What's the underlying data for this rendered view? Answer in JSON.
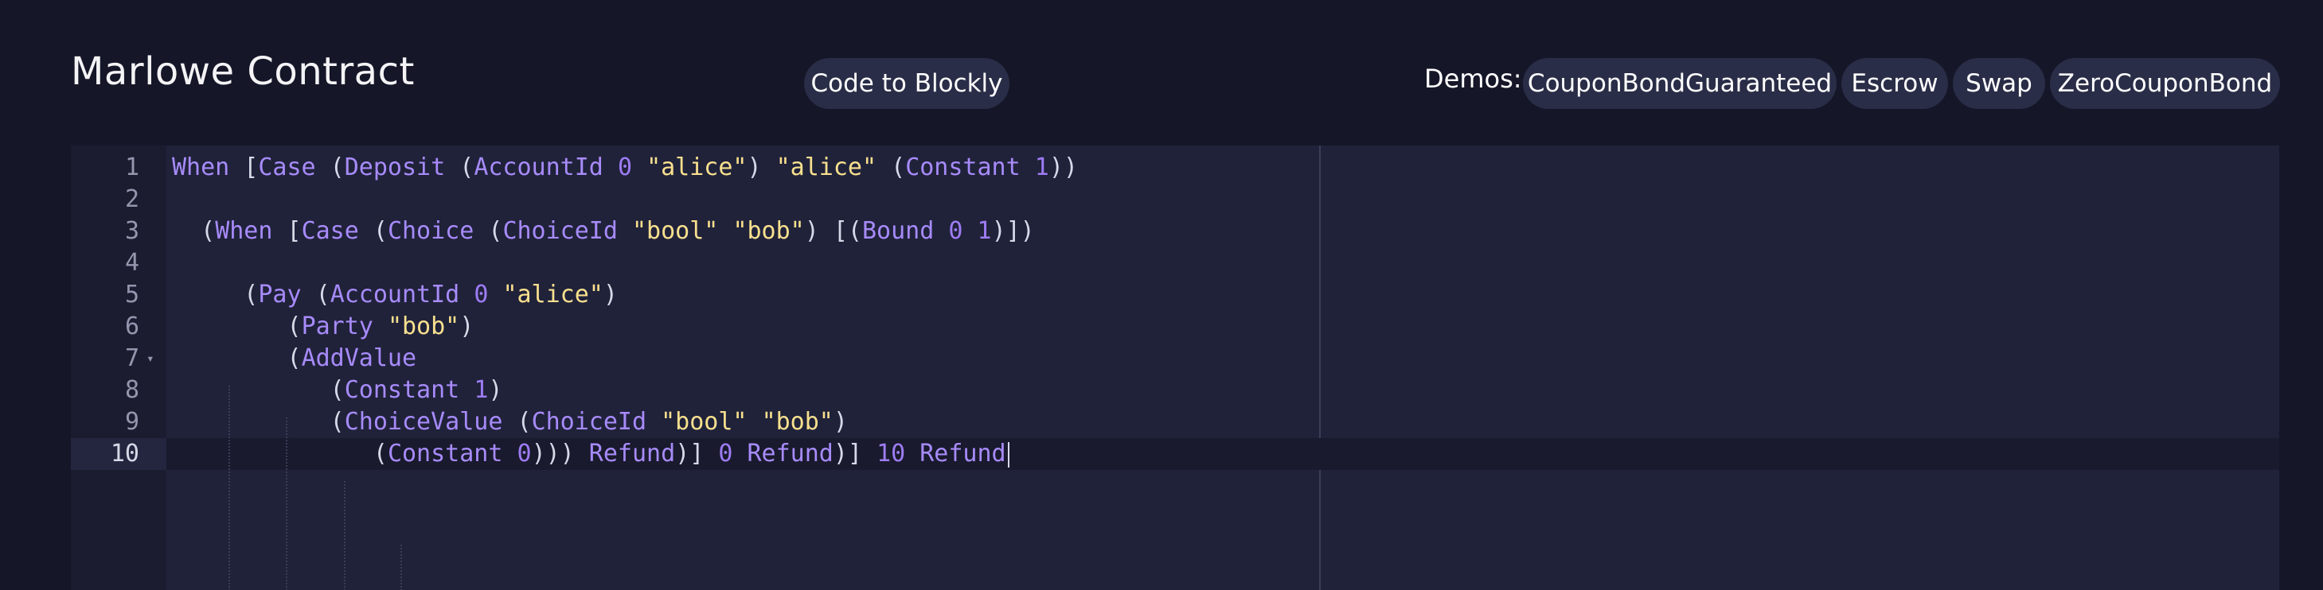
{
  "app": {
    "title": "Marlowe Contract"
  },
  "toolbar": {
    "code_to_blockly": "Code to Blockly"
  },
  "demos": {
    "label": "Demos:",
    "items": [
      "CouponBondGuaranteed",
      "Escrow",
      "Swap",
      "ZeroCouponBond"
    ]
  },
  "editor": {
    "active_line": 10,
    "colors": {
      "keyword": "#a78bfa",
      "string": "#f8e08e",
      "number": "#9e7cf4",
      "text": "#d7d9e8"
    },
    "lines": [
      {
        "num": "1",
        "tokens": [
          [
            "kw",
            "When"
          ],
          [
            "p",
            " ["
          ],
          [
            "kw",
            "Case"
          ],
          [
            "p",
            " ("
          ],
          [
            "kw",
            "Deposit"
          ],
          [
            "p",
            " ("
          ],
          [
            "kw",
            "AccountId"
          ],
          [
            "p",
            " "
          ],
          [
            "num",
            "0"
          ],
          [
            "p",
            " "
          ],
          [
            "str",
            "\"alice\""
          ],
          [
            "p",
            ") "
          ],
          [
            "str",
            "\"alice\""
          ],
          [
            "p",
            " ("
          ],
          [
            "kw",
            "Constant"
          ],
          [
            "p",
            " "
          ],
          [
            "num",
            "1"
          ],
          [
            "p",
            "))"
          ]
        ]
      },
      {
        "num": "2",
        "tokens": []
      },
      {
        "num": "3",
        "tokens": [
          [
            "p",
            "  ("
          ],
          [
            "kw",
            "When"
          ],
          [
            "p",
            " ["
          ],
          [
            "kw",
            "Case"
          ],
          [
            "p",
            " ("
          ],
          [
            "kw",
            "Choice"
          ],
          [
            "p",
            " ("
          ],
          [
            "kw",
            "ChoiceId"
          ],
          [
            "p",
            " "
          ],
          [
            "str",
            "\"bool\""
          ],
          [
            "p",
            " "
          ],
          [
            "str",
            "\"bob\""
          ],
          [
            "p",
            ") [("
          ],
          [
            "kw",
            "Bound"
          ],
          [
            "p",
            " "
          ],
          [
            "num",
            "0"
          ],
          [
            "p",
            " "
          ],
          [
            "num",
            "1"
          ],
          [
            "p",
            ")])"
          ]
        ]
      },
      {
        "num": "4",
        "tokens": []
      },
      {
        "num": "5",
        "tokens": [
          [
            "p",
            "     ("
          ],
          [
            "kw",
            "Pay"
          ],
          [
            "p",
            " ("
          ],
          [
            "kw",
            "AccountId"
          ],
          [
            "p",
            " "
          ],
          [
            "num",
            "0"
          ],
          [
            "p",
            " "
          ],
          [
            "str",
            "\"alice\""
          ],
          [
            "p",
            ")"
          ]
        ]
      },
      {
        "num": "6",
        "tokens": [
          [
            "p",
            "        ("
          ],
          [
            "kw",
            "Party"
          ],
          [
            "p",
            " "
          ],
          [
            "str",
            "\"bob\""
          ],
          [
            "p",
            ")"
          ]
        ]
      },
      {
        "num": "7",
        "fold": true,
        "tokens": [
          [
            "p",
            "        ("
          ],
          [
            "kw",
            "AddValue"
          ]
        ]
      },
      {
        "num": "8",
        "tokens": [
          [
            "p",
            "           ("
          ],
          [
            "kw",
            "Constant"
          ],
          [
            "p",
            " "
          ],
          [
            "num",
            "1"
          ],
          [
            "p",
            ")"
          ]
        ]
      },
      {
        "num": "9",
        "tokens": [
          [
            "p",
            "           ("
          ],
          [
            "kw",
            "ChoiceValue"
          ],
          [
            "p",
            " ("
          ],
          [
            "kw",
            "ChoiceId"
          ],
          [
            "p",
            " "
          ],
          [
            "str",
            "\"bool\""
          ],
          [
            "p",
            " "
          ],
          [
            "str",
            "\"bob\""
          ],
          [
            "p",
            ")"
          ]
        ]
      },
      {
        "num": "10",
        "tokens": [
          [
            "p",
            "              ("
          ],
          [
            "kw",
            "Constant"
          ],
          [
            "p",
            " "
          ],
          [
            "num",
            "0"
          ],
          [
            "p",
            ")))"
          ],
          [
            "kw",
            " Refund"
          ],
          [
            "p",
            ")] "
          ],
          [
            "num",
            "0"
          ],
          [
            "kw",
            " Refund"
          ],
          [
            "p",
            ")] "
          ],
          [
            "num",
            "10"
          ],
          [
            "kw",
            " Refund"
          ]
        ]
      }
    ]
  }
}
